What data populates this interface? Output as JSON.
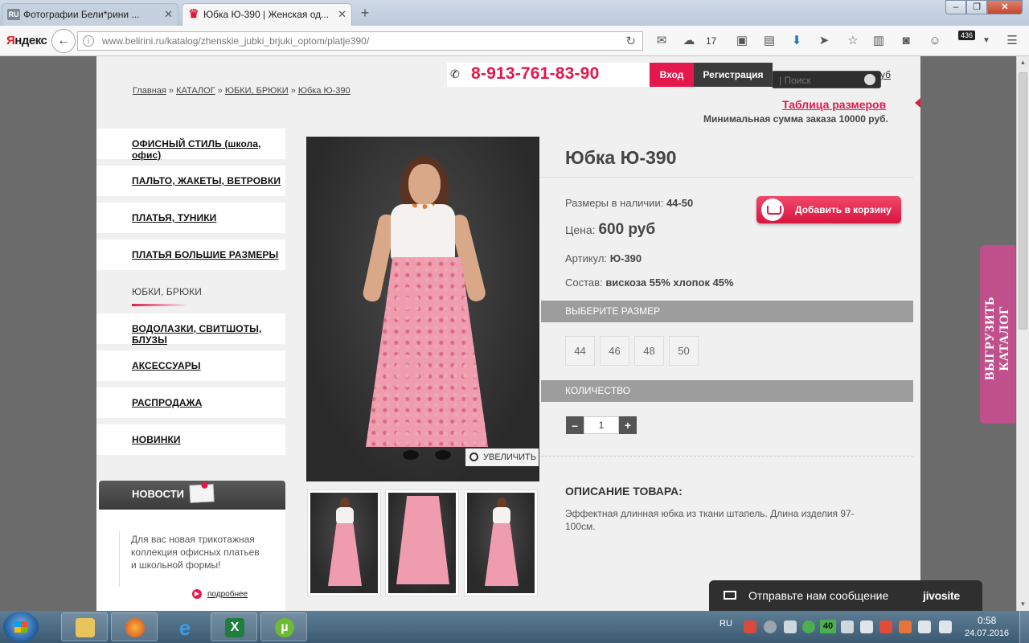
{
  "browser": {
    "tabs": [
      {
        "label": "Фотографии Бели*рини ...",
        "favicon": "RU"
      },
      {
        "label": "Юбка Ю-390 | Женская од..."
      }
    ],
    "logo_prefix": "Я",
    "logo_rest": "ндекс",
    "url": "www.belirini.ru/katalog/zhenskie_jubki_brjuki_optom/platje390/",
    "weather_temp": "17",
    "notif_count": "436"
  },
  "header": {
    "phone": "8-913-761-83-90",
    "login": "Вход",
    "register": "Регистрация",
    "search_placeholder": "| Поиск",
    "cart_peek": "уб",
    "size_table": "Таблица размеров",
    "min_order": "Минимальная сумма заказа 10000 руб."
  },
  "breadcrumb": {
    "home": "Главная",
    "catalog": "КАТАЛОГ",
    "category": "ЮБКИ, БРЮКИ",
    "current": "Юбка Ю-390",
    "sep": " » "
  },
  "sidebar": {
    "items": [
      {
        "label": "ОФИСНЫЙ СТИЛЬ (школа, офис)"
      },
      {
        "label": "ПАЛЬТО, ЖАКЕТЫ, ВЕТРОВКИ"
      },
      {
        "label": "ПЛАТЬЯ, ТУНИКИ"
      },
      {
        "label": "ПЛАТЬЯ БОЛЬШИЕ РАЗМЕРЫ"
      },
      {
        "label": "ЮБКИ, БРЮКИ"
      },
      {
        "label": "ВОДОЛАЗКИ, СВИТШОТЫ, БЛУЗЫ"
      },
      {
        "label": "АКСЕССУАРЫ"
      },
      {
        "label": "РАСПРОДАЖА"
      },
      {
        "label": "НОВИНКИ"
      }
    ],
    "active_index": 4
  },
  "news": {
    "title": "НОВОСТИ",
    "text": "Для вас новая трикотажная коллекция офисных платьев и школьной формы!",
    "more": "подробнее"
  },
  "product": {
    "zoom_label": "УВЕЛИЧИТЬ",
    "title": "Юбка Ю-390",
    "sizes_label": "Размеры в наличии:",
    "sizes_value": "44-50",
    "price_label": "Цена:",
    "price_value": "600 руб",
    "sku_label": "Артикул:",
    "sku_value": "Ю-390",
    "composition_label": "Состав:",
    "composition_value": "вискоза 55% хлопок 45%",
    "add_to_cart": "Добавить в корзину",
    "choose_size": "ВЫБЕРИТЕ РАЗМЕР",
    "size_options": [
      "44",
      "46",
      "48",
      "50"
    ],
    "quantity_label": "КОЛИЧЕСТВО",
    "quantity_value": "1",
    "minus": "–",
    "plus": "+",
    "description_title": "ОПИСАНИЕ ТОВАРА:",
    "description": "Эффектная длинная юбка из ткани штапель. Длина изделия 97-100см."
  },
  "catalog_tab": "ВЫГРУЗИТЬ КАТАЛОГ",
  "jivo": {
    "message": "Отправьте нам сообщение",
    "brand": "jivosite"
  },
  "taskbar": {
    "lang": "RU",
    "badge": "40",
    "time": "0:58",
    "date": "24.07.2016",
    "ie_glyph": "e",
    "excel_glyph": "X",
    "utorrent_glyph": "µ"
  },
  "colors": {
    "accent": "#e5174c",
    "catalog_tab": "#c0508b",
    "dark": "#3b3b3b"
  }
}
